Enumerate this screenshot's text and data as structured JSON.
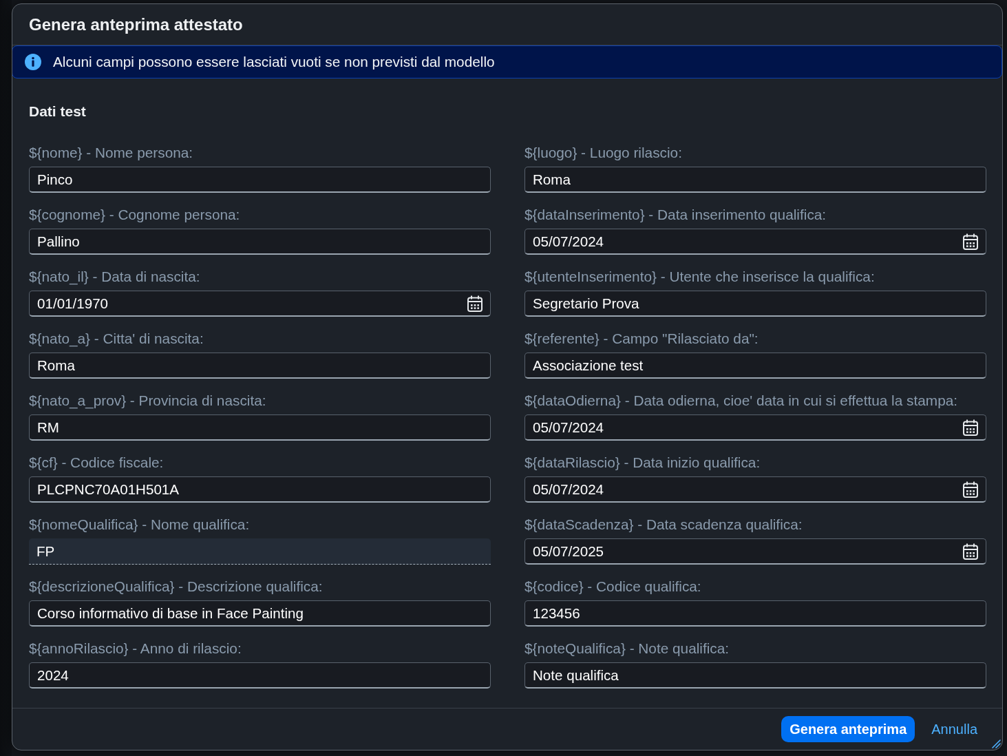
{
  "dialog": {
    "title": "Genera anteprima attestato",
    "info_message": "Alcuni campi possono essere lasciati vuoti se non previsti dal modello",
    "section_title": "Dati test",
    "columns": [
      {
        "fields": [
          {
            "label": "${nome} - Nome persona:",
            "value": "Pinco",
            "kind": "text"
          },
          {
            "label": "${cognome} - Cognome persona:",
            "value": "Pallino",
            "kind": "text"
          },
          {
            "label": "${nato_il} - Data di nascita:",
            "value": "01/01/1970",
            "kind": "date"
          },
          {
            "label": "${nato_a} - Citta' di nascita:",
            "value": "Roma",
            "kind": "text"
          },
          {
            "label": "${nato_a_prov} - Provincia di nascita:",
            "value": "RM",
            "kind": "text"
          },
          {
            "label": "${cf} - Codice fiscale:",
            "value": "PLCPNC70A01H501A",
            "kind": "text"
          },
          {
            "label": "${nomeQualifica} - Nome qualifica:",
            "value": "FP",
            "kind": "readonly"
          },
          {
            "label": "${descrizioneQualifica} - Descrizione qualifica:",
            "value": "Corso informativo di base in Face Painting",
            "kind": "text"
          },
          {
            "label": "${annoRilascio} - Anno di rilascio:",
            "value": "2024",
            "kind": "text"
          }
        ]
      },
      {
        "fields": [
          {
            "label": "${luogo} - Luogo rilascio:",
            "value": "Roma",
            "kind": "text"
          },
          {
            "label": "${dataInserimento} - Data inserimento qualifica:",
            "value": "05/07/2024",
            "kind": "date"
          },
          {
            "label": "${utenteInserimento} - Utente che inserisce la qualifica:",
            "value": "Segretario Prova",
            "kind": "text"
          },
          {
            "label": "${referente} - Campo \"Rilasciato da\":",
            "value": "Associazione test",
            "kind": "text"
          },
          {
            "label": "${dataOdierna} - Data odierna, cioe' data in cui si effettua la stampa:",
            "value": "05/07/2024",
            "kind": "date"
          },
          {
            "label": "${dataRilascio} - Data inizio qualifica:",
            "value": "05/07/2024",
            "kind": "date"
          },
          {
            "label": "${dataScadenza} - Data scadenza qualifica:",
            "value": "05/07/2025",
            "kind": "date"
          },
          {
            "label": "${codice} - Codice qualifica:",
            "value": "123456",
            "kind": "text"
          },
          {
            "label": "${noteQualifica} - Note qualifica:",
            "value": "Note qualifica",
            "kind": "text"
          }
        ]
      }
    ],
    "buttons": [
      {
        "label": "Genera anteprima",
        "kind": "emphasized"
      },
      {
        "label": "Annulla",
        "kind": "transparent"
      }
    ]
  }
}
